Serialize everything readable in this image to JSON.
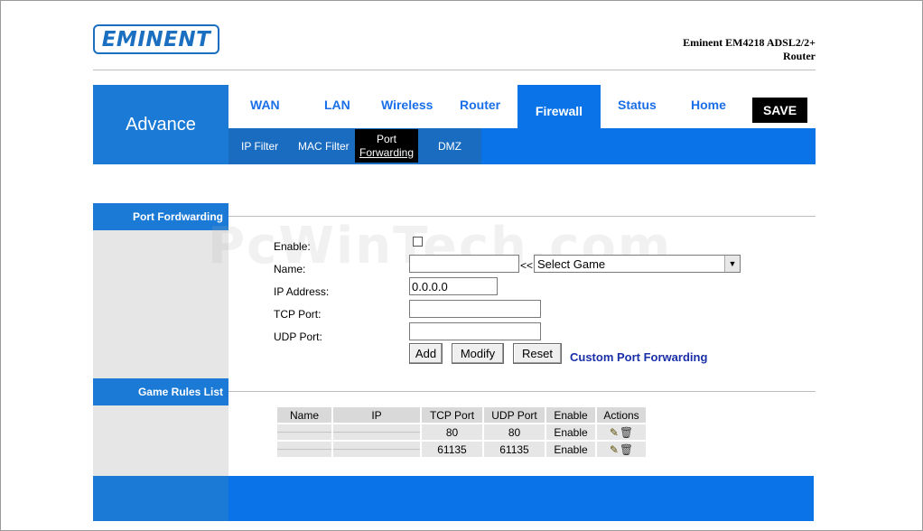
{
  "header": {
    "logo_text": "EMINENT",
    "model_line1": "Eminent EM4218 ADSL2/2+",
    "model_line2": "Router"
  },
  "nav": {
    "section_label": "Advance",
    "tabs": [
      {
        "label": "WAN"
      },
      {
        "label": "LAN"
      },
      {
        "label": "Wireless"
      },
      {
        "label": "Router"
      },
      {
        "label": "Firewall",
        "active": true
      },
      {
        "label": "Status"
      },
      {
        "label": "Home"
      }
    ],
    "save_label": "SAVE",
    "subtabs": [
      {
        "label": "IP Filter"
      },
      {
        "label": "MAC Filter"
      },
      {
        "label_line1": "Port",
        "label_line2": "Forwarding",
        "active": true
      },
      {
        "label": "DMZ"
      }
    ]
  },
  "port_forwarding": {
    "section_title": "Port Fordwarding",
    "enable_label": "Enable:",
    "enable_checked": false,
    "name_label": "Name:",
    "name_value": "",
    "select_prefix": "<<",
    "select_value": "Select Game",
    "ip_label": "IP Address:",
    "ip_value": "0.0.0.0",
    "tcp_label": "TCP Port:",
    "tcp_value": "",
    "udp_label": "UDP Port:",
    "udp_value": "",
    "buttons": {
      "add": "Add",
      "modify": "Modify",
      "reset": "Reset"
    },
    "custom_link": "Custom Port Forwarding"
  },
  "game_rules": {
    "section_title": "Game Rules List",
    "columns": [
      "Name",
      "IP",
      "TCP Port",
      "UDP Port",
      "Enable",
      "Actions"
    ],
    "rows": [
      {
        "name": "",
        "ip": "",
        "tcp": "80",
        "udp": "80",
        "enable": "Enable"
      },
      {
        "name": "",
        "ip": "",
        "tcp": "61135",
        "udp": "61135",
        "enable": "Enable"
      }
    ]
  },
  "watermark": "PcWinTech.com",
  "colors": {
    "nav_blue": "#0a73e8",
    "section_blue": "#1a7ad6",
    "link_blue": "#1a2fa8"
  }
}
